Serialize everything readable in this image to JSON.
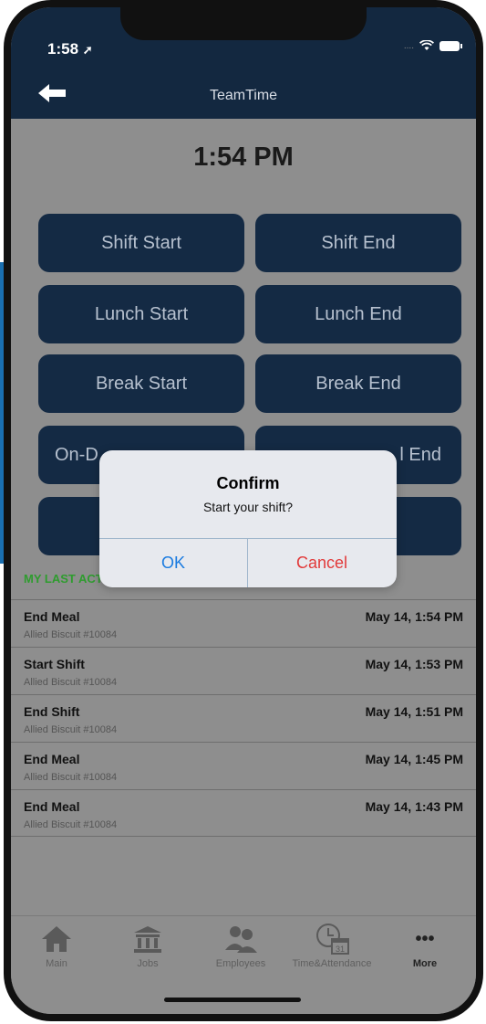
{
  "status_bar": {
    "time": "1:58",
    "signal": "....",
    "location_icon": "location-arrow-icon"
  },
  "nav": {
    "title": "TeamTime",
    "back_icon": "back-arrow-icon"
  },
  "clock_display": "1:54 PM",
  "buttons": {
    "shift_start": "Shift Start",
    "shift_end": "Shift End",
    "lunch_start": "Lunch Start",
    "lunch_end": "Lunch End",
    "break_start": "Break Start",
    "break_end": "Break End",
    "on_duty_partial": "On-D",
    "meal_end_partial": "l End"
  },
  "section_label": "MY LAST ACTIONS",
  "actions": [
    {
      "action": "End Meal",
      "location": "Allied Biscuit #10084",
      "when": "May 14, 1:54 PM"
    },
    {
      "action": "Start Shift",
      "location": "Allied Biscuit #10084",
      "when": "May 14, 1:53 PM"
    },
    {
      "action": "End Shift",
      "location": "Allied Biscuit #10084",
      "when": "May 14, 1:51 PM"
    },
    {
      "action": "End Meal",
      "location": "Allied Biscuit #10084",
      "when": "May 14, 1:45 PM"
    },
    {
      "action": "End Meal",
      "location": "Allied Biscuit #10084",
      "when": "May 14, 1:43 PM"
    }
  ],
  "tabs": [
    {
      "label": "Main",
      "icon": "home-icon"
    },
    {
      "label": "Jobs",
      "icon": "bank-icon"
    },
    {
      "label": "Employees",
      "icon": "people-icon"
    },
    {
      "label": "Time&Attendance",
      "icon": "clock-calendar-icon",
      "badge": "31"
    },
    {
      "label": "More",
      "icon": "more-dots-icon",
      "glyph": "•••"
    }
  ],
  "dialog": {
    "title": "Confirm",
    "message": "Start your shift?",
    "ok": "OK",
    "cancel": "Cancel"
  },
  "colors": {
    "navbar": "#132840",
    "button": "#142a44",
    "section_label": "#2e9c2e",
    "ok": "#1a7be0",
    "cancel": "#e23a3a"
  }
}
